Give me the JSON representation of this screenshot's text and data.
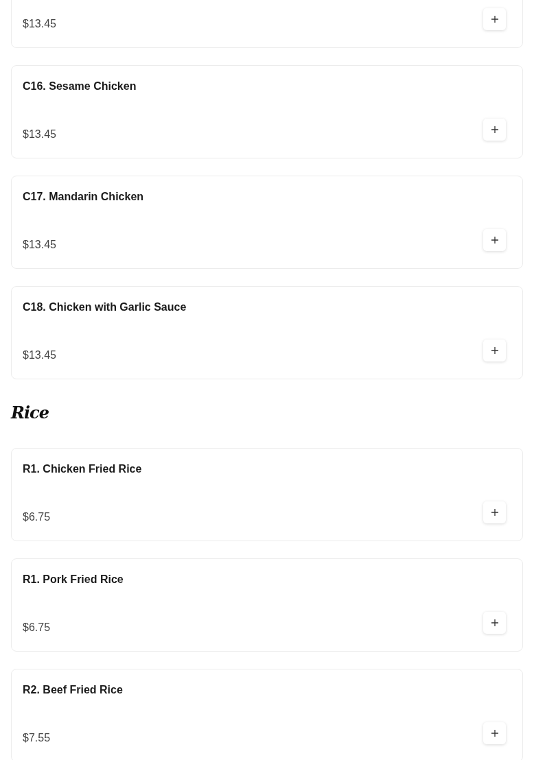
{
  "sections": [
    {
      "items": [
        {
          "price": "$13.45"
        },
        {
          "name": "C16. Sesame Chicken",
          "price": "$13.45"
        },
        {
          "name": "C17. Mandarin Chicken",
          "price": "$13.45"
        },
        {
          "name": "C18. Chicken with Garlic Sauce",
          "price": "$13.45"
        }
      ]
    },
    {
      "heading": "Rice",
      "items": [
        {
          "name": "R1. Chicken Fried Rice",
          "price": "$6.75"
        },
        {
          "name": "R1. Pork Fried Rice",
          "price": "$6.75"
        },
        {
          "name": "R2. Beef Fried Rice",
          "price": "$7.55"
        }
      ]
    }
  ]
}
